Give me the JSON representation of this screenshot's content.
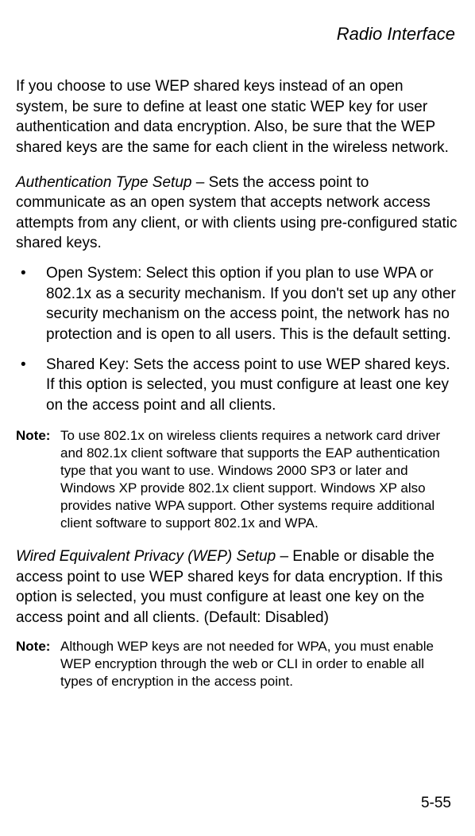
{
  "header": "Radio Interface",
  "intro": "If you choose to use WEP shared keys instead of an open system, be sure to define at least one static WEP key for user authentication and data encryption. Also, be sure that the WEP shared keys are the same for each client in the wireless network.",
  "auth_title": "Authentication Type Setup",
  "auth_desc": " – Sets the access point to communicate as an open system that accepts network access attempts from any client, or with clients using pre-configured static shared keys.",
  "bullets": [
    "Open System: Select this option if you plan to use WPA or 802.1x as a security mechanism. If you don't set up any other security mechanism on the access point, the network has no protection and is open to all users. This is the default setting.",
    "Shared Key: Sets the access point to use WEP shared keys. If this option is selected, you must configure at least one key on the access point and all clients."
  ],
  "note1_label": "Note:",
  "note1_text": "To use 802.1x on wireless clients requires a network card driver and 802.1x client software that supports the EAP authentication type that you want to use. Windows 2000 SP3 or later and Windows XP provide 802.1x client support. Windows XP also provides native WPA support. Other systems require additional client software to support 802.1x and WPA.",
  "wep_title": "Wired Equivalent Privacy (WEP) Setup",
  "wep_desc": " – Enable or disable the access point to use WEP shared keys for data encryption. If this option is selected, you must configure at least one key on the access point and all clients. (Default: Disabled)",
  "note2_label": "Note:",
  "note2_text": "Although WEP keys are not needed for WPA, you must enable WEP encryption through the web or CLI in order to enable all types of encryption in the access point.",
  "page_number": "5-55"
}
